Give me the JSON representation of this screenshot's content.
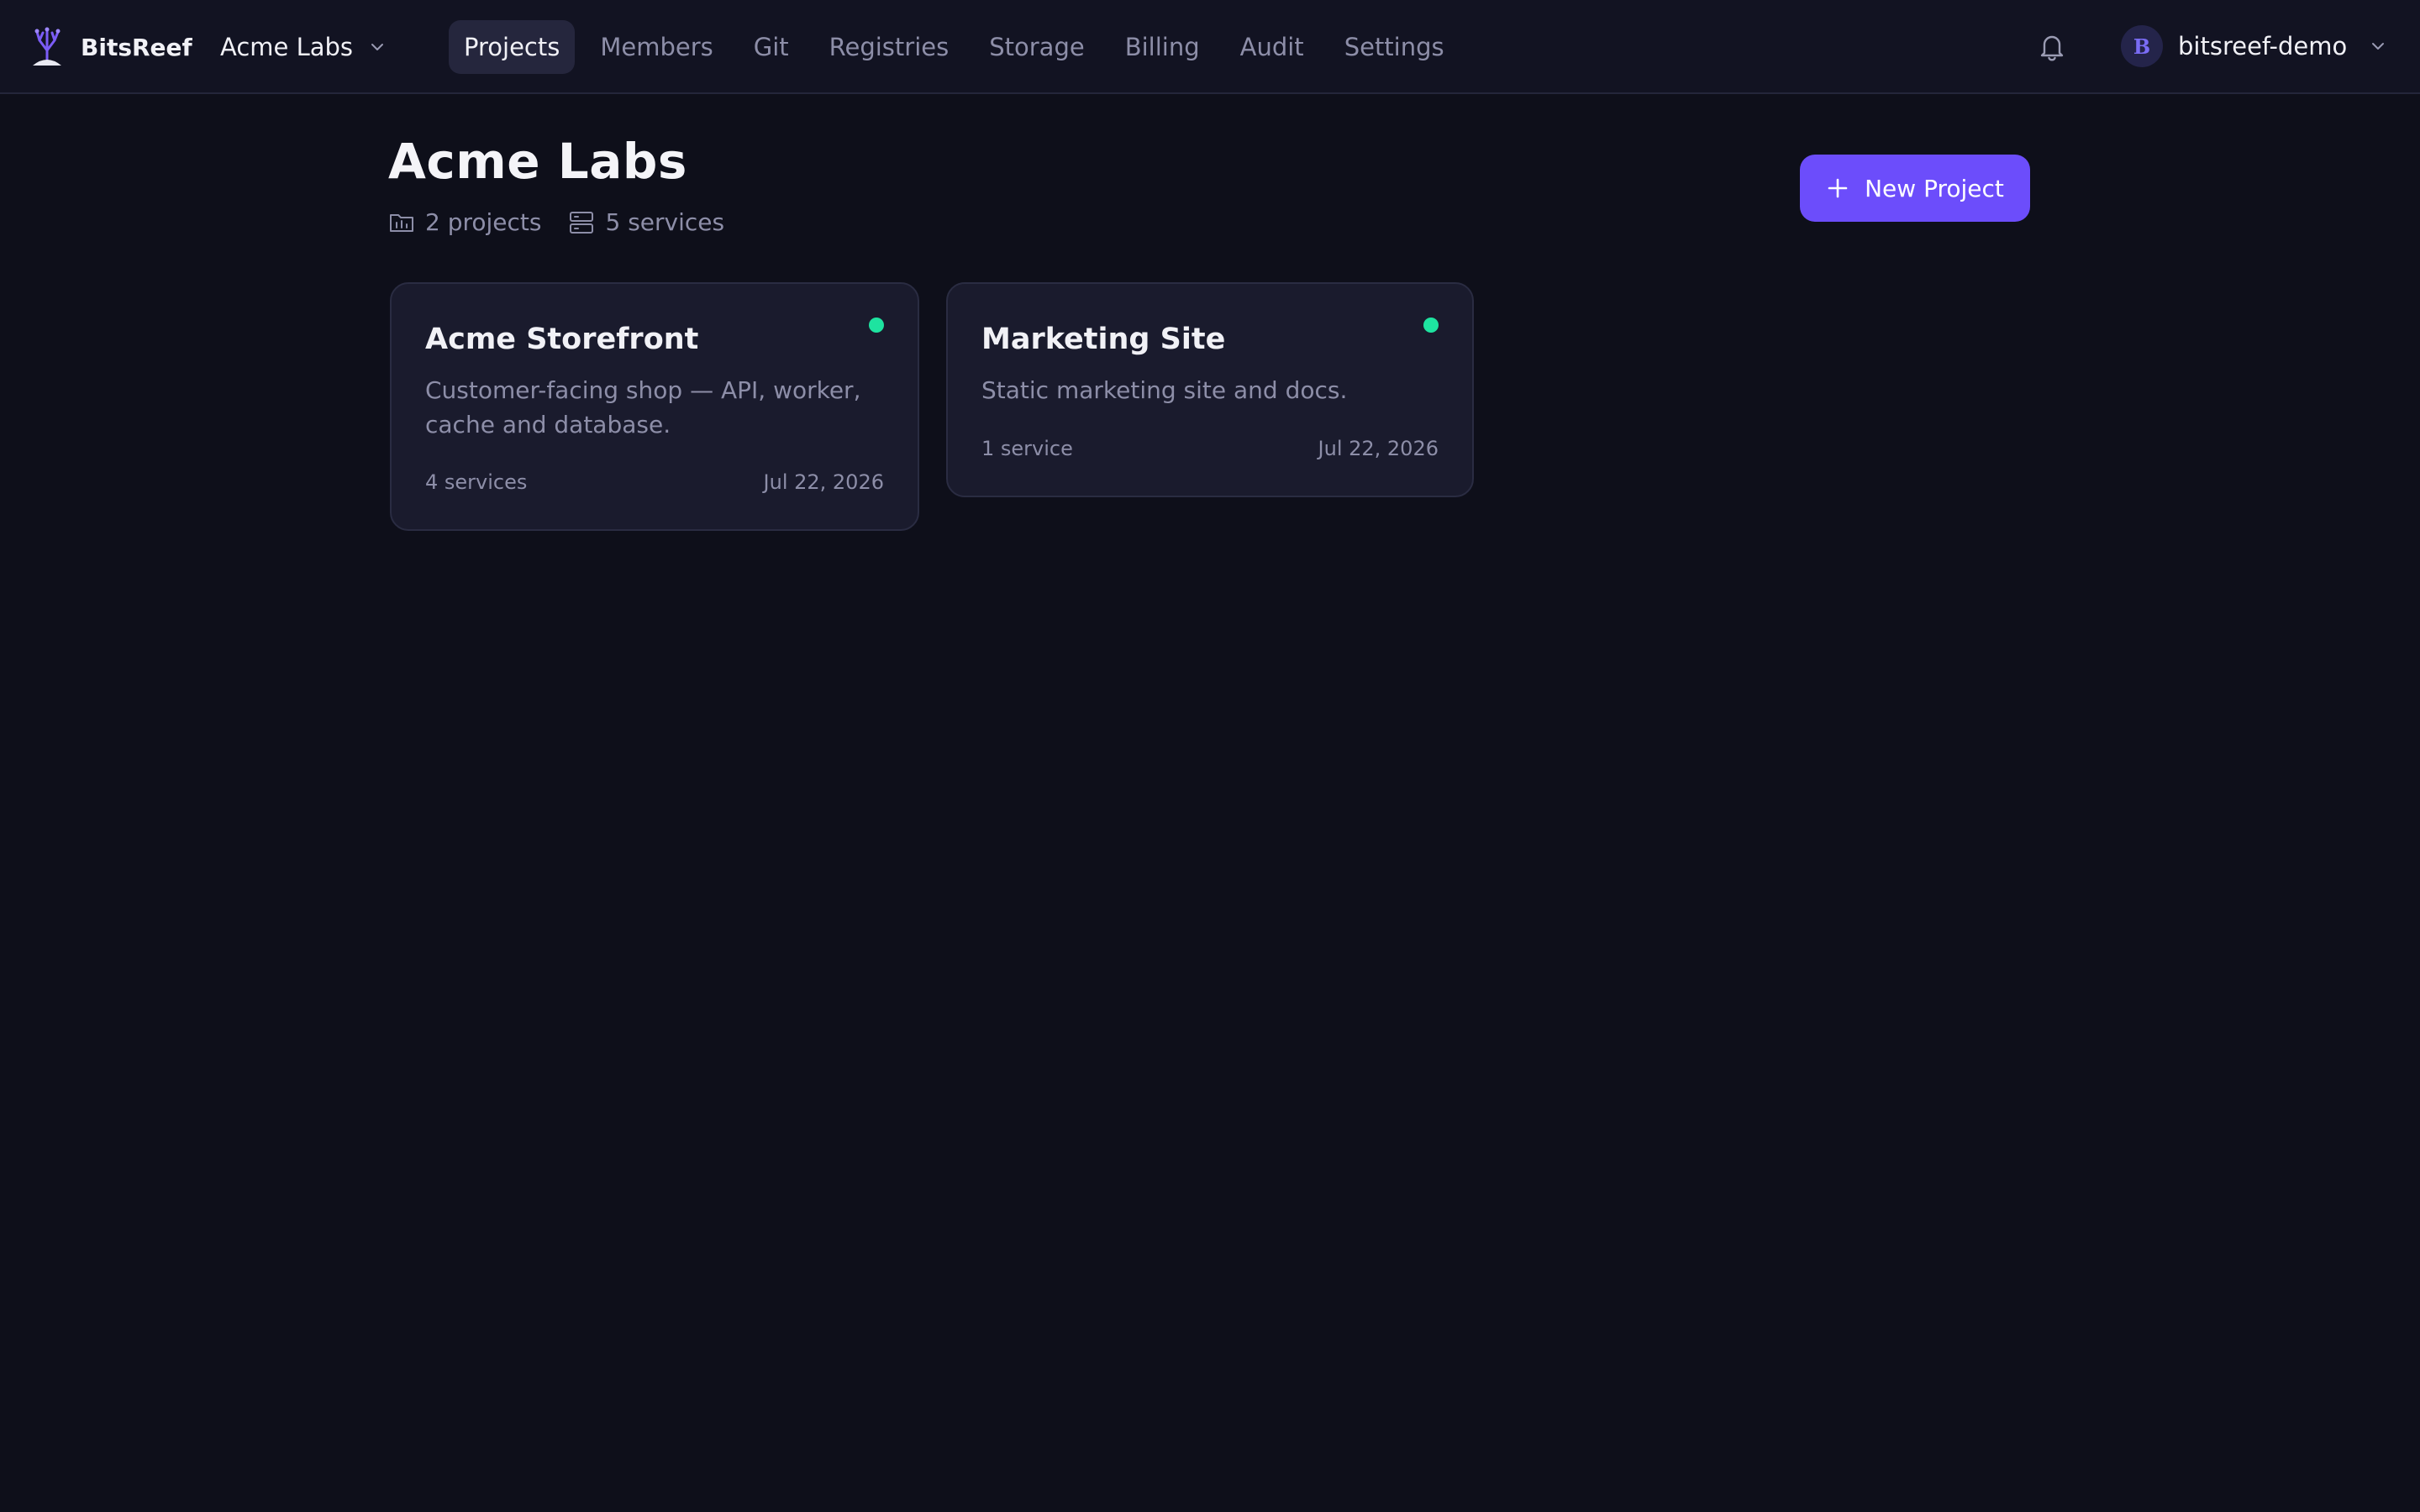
{
  "app": {
    "name": "BitsReef"
  },
  "org_switcher": {
    "label": "Acme Labs"
  },
  "nav": {
    "items": [
      {
        "label": "Projects",
        "active": true
      },
      {
        "label": "Members"
      },
      {
        "label": "Git"
      },
      {
        "label": "Registries"
      },
      {
        "label": "Storage"
      },
      {
        "label": "Billing"
      },
      {
        "label": "Audit"
      },
      {
        "label": "Settings"
      }
    ]
  },
  "user": {
    "initial": "B",
    "name": "bitsreef-demo"
  },
  "page": {
    "title": "Acme Labs",
    "projects_count": "2 projects",
    "services_count": "5 services",
    "new_project_label": "New Project"
  },
  "projects": [
    {
      "name": "Acme Storefront",
      "description": "Customer-facing shop — API, worker, cache and database.",
      "services": "4 services",
      "date": "Jul 22, 2026",
      "status_color": "#1ee3a0"
    },
    {
      "name": "Marketing Site",
      "description": "Static marketing site and docs.",
      "services": "1 service",
      "date": "Jul 22, 2026",
      "status_color": "#1ee3a0"
    }
  ],
  "icons": {
    "logo": "coral-logo-icon",
    "chevron": "chevron-down-icon",
    "bell": "bell-icon",
    "projects": "folder-icon",
    "services": "server-icon",
    "plus": "plus-icon"
  },
  "colors": {
    "accent": "#6c4dfb",
    "status_ok": "#1ee3a0",
    "background": "#0e0f1a",
    "card": "#1a1b2d"
  }
}
